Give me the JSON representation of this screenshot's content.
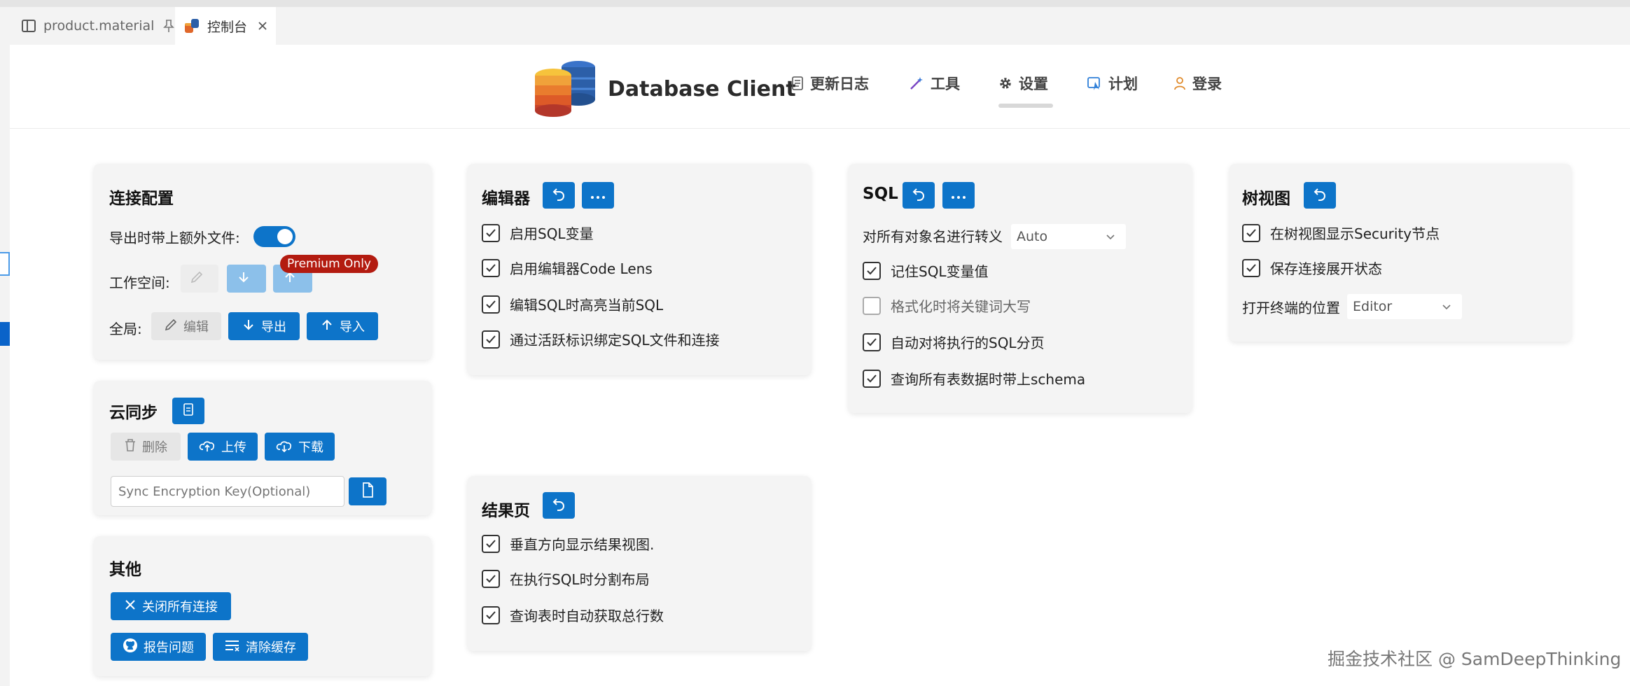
{
  "tabs": [
    {
      "label": "product.material",
      "icon": "split-editor-icon",
      "action_icon": "pin-icon"
    },
    {
      "label": "控制台",
      "icon": "database-app-icon",
      "action_icon": "close-icon"
    }
  ],
  "brand": {
    "title": "Database Client",
    "logo": "database-stack-logo"
  },
  "nav": [
    {
      "label": "更新日志",
      "icon": "changelog-icon"
    },
    {
      "label": "工具",
      "icon": "wand-icon"
    },
    {
      "label": "设置",
      "icon": "gear-icon",
      "active": true
    },
    {
      "label": "计划",
      "icon": "plan-icon"
    },
    {
      "label": "登录",
      "icon": "user-icon"
    }
  ],
  "connection": {
    "title": "连接配置",
    "export_extra_label": "导出时带上额外文件:",
    "export_extra_on": true,
    "workspace_label": "工作空间:",
    "premium_badge": "Premium Only",
    "global_label": "全局:",
    "edit_btn": "编辑",
    "export_btn": "导出",
    "import_btn": "导入"
  },
  "cloud": {
    "title": "云同步",
    "delete_btn": "删除",
    "upload_btn": "上传",
    "download_btn": "下载",
    "key_placeholder": "Sync Encryption Key(Optional)"
  },
  "other": {
    "title": "其他",
    "close_all_btn": "关闭所有连接",
    "report_btn": "报告问题",
    "clear_cache_btn": "清除缓存"
  },
  "editor": {
    "title": "编辑器",
    "options": [
      {
        "label": "启用SQL变量",
        "checked": true
      },
      {
        "label": "启用编辑器Code Lens",
        "checked": true
      },
      {
        "label": "编辑SQL时高亮当前SQL",
        "checked": true
      },
      {
        "label": "通过活跃标识绑定SQL文件和连接",
        "checked": true
      }
    ]
  },
  "result": {
    "title": "结果页",
    "options": [
      {
        "label": "垂直方向显示结果视图.",
        "checked": true
      },
      {
        "label": "在执行SQL时分割布局",
        "checked": true
      },
      {
        "label": "查询表时自动获取总行数",
        "checked": true
      }
    ]
  },
  "sql": {
    "title": "SQL",
    "escape_label": "对所有对象名进行转义",
    "escape_value": "Auto",
    "options": [
      {
        "label": "记住SQL变量值",
        "checked": true
      },
      {
        "label": "格式化时将关键词大写",
        "checked": false
      },
      {
        "label": "自动对将执行的SQL分页",
        "checked": true
      },
      {
        "label": "查询所有表数据时带上schema",
        "checked": true
      }
    ]
  },
  "tree": {
    "title": "树视图",
    "options": [
      {
        "label": "在树视图显示Security节点",
        "checked": true
      },
      {
        "label": "保存连接展开状态",
        "checked": true
      }
    ],
    "terminal_label": "打开终端的位置",
    "terminal_value": "Editor"
  },
  "colors": {
    "accent": "#0d74c9",
    "premium": "#b31b10",
    "card_bg": "#f4f4f4"
  },
  "watermark": "掘金技术社区 @ SamDeepThinking"
}
